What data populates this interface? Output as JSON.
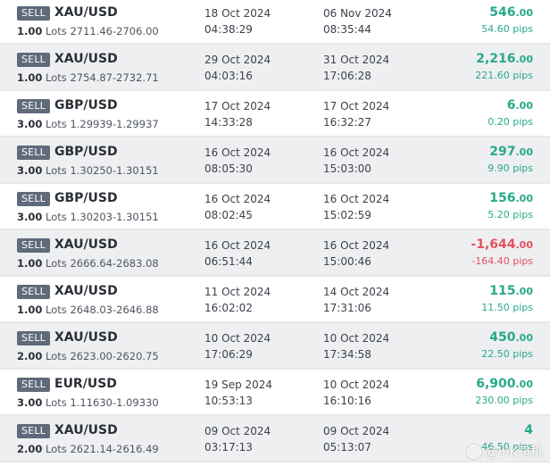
{
  "colors": {
    "positive": "#28a98a",
    "negative": "#e5505f",
    "side_badge": "#5f6a7a"
  },
  "trades": [
    {
      "side": "SELL",
      "symbol": "XAU/USD",
      "lots": "1.00",
      "lots_unit": "Lots",
      "prices": "2711.46-2706.00",
      "open_date": "18 Oct 2024",
      "open_time": "04:38:29",
      "close_date": "06 Nov 2024",
      "close_time": "08:35:44",
      "profit_int": "546",
      "profit_dec": ".00",
      "pips": "54.60 pips",
      "positive": true
    },
    {
      "side": "SELL",
      "symbol": "XAU/USD",
      "lots": "1.00",
      "lots_unit": "Lots",
      "prices": "2754.87-2732.71",
      "open_date": "29 Oct 2024",
      "open_time": "04:03:16",
      "close_date": "31 Oct 2024",
      "close_time": "17:06:28",
      "profit_int": "2,216",
      "profit_dec": ".00",
      "pips": "221.60 pips",
      "positive": true
    },
    {
      "side": "SELL",
      "symbol": "GBP/USD",
      "lots": "3.00",
      "lots_unit": "Lots",
      "prices": "1.29939-1.29937",
      "open_date": "17 Oct 2024",
      "open_time": "14:33:28",
      "close_date": "17 Oct 2024",
      "close_time": "16:32:27",
      "profit_int": "6",
      "profit_dec": ".00",
      "pips": "0.20 pips",
      "positive": true
    },
    {
      "side": "SELL",
      "symbol": "GBP/USD",
      "lots": "3.00",
      "lots_unit": "Lots",
      "prices": "1.30250-1.30151",
      "open_date": "16 Oct 2024",
      "open_time": "08:05:30",
      "close_date": "16 Oct 2024",
      "close_time": "15:03:00",
      "profit_int": "297",
      "profit_dec": ".00",
      "pips": "9.90 pips",
      "positive": true
    },
    {
      "side": "SELL",
      "symbol": "GBP/USD",
      "lots": "3.00",
      "lots_unit": "Lots",
      "prices": "1.30203-1.30151",
      "open_date": "16 Oct 2024",
      "open_time": "08:02:45",
      "close_date": "16 Oct 2024",
      "close_time": "15:02:59",
      "profit_int": "156",
      "profit_dec": ".00",
      "pips": "5.20 pips",
      "positive": true
    },
    {
      "side": "SELL",
      "symbol": "XAU/USD",
      "lots": "1.00",
      "lots_unit": "Lots",
      "prices": "2666.64-2683.08",
      "open_date": "16 Oct 2024",
      "open_time": "06:51:44",
      "close_date": "16 Oct 2024",
      "close_time": "15:00:46",
      "profit_int": "-1,644",
      "profit_dec": ".00",
      "pips": "-164.40 pips",
      "positive": false
    },
    {
      "side": "SELL",
      "symbol": "XAU/USD",
      "lots": "1.00",
      "lots_unit": "Lots",
      "prices": "2648.03-2646.88",
      "open_date": "11 Oct 2024",
      "open_time": "16:02:02",
      "close_date": "14 Oct 2024",
      "close_time": "17:31:06",
      "profit_int": "115",
      "profit_dec": ".00",
      "pips": "11.50 pips",
      "positive": true
    },
    {
      "side": "SELL",
      "symbol": "XAU/USD",
      "lots": "2.00",
      "lots_unit": "Lots",
      "prices": "2623.00-2620.75",
      "open_date": "10 Oct 2024",
      "open_time": "17:06:29",
      "close_date": "10 Oct 2024",
      "close_time": "17:34:58",
      "profit_int": "450",
      "profit_dec": ".00",
      "pips": "22.50 pips",
      "positive": true
    },
    {
      "side": "SELL",
      "symbol": "EUR/USD",
      "lots": "3.00",
      "lots_unit": "Lots",
      "prices": "1.11630-1.09330",
      "open_date": "19 Sep 2024",
      "open_time": "10:53:13",
      "close_date": "10 Oct 2024",
      "close_time": "16:10:16",
      "profit_int": "6,900",
      "profit_dec": ".00",
      "pips": "230.00 pips",
      "positive": true
    },
    {
      "side": "SELL",
      "symbol": "XAU/USD",
      "lots": "2.00",
      "lots_unit": "Lots",
      "prices": "2621.14-2616.49",
      "open_date": "09 Oct 2024",
      "open_time": "03:17:13",
      "close_date": "09 Oct 2024",
      "close_time": "05:13:07",
      "profit_int": "4",
      "profit_dec": "",
      "pips": "46.50 pips",
      "positive": true
    }
  ],
  "watermark": {
    "text": "@小K司机"
  }
}
